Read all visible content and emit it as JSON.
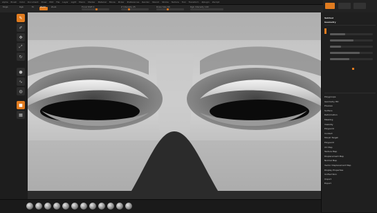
{
  "menubar": {
    "items": [
      "Alpha",
      "Brush",
      "Color",
      "Document",
      "Draw",
      "Edit",
      "File",
      "Layer",
      "Light",
      "Macro",
      "Marker",
      "Material",
      "Movie",
      "Picker",
      "Preferences",
      "Render",
      "Stencil",
      "Stroke",
      "Texture",
      "Tool",
      "Transform",
      "Zplugin",
      "Zscript"
    ]
  },
  "topbar": {
    "mrgb": "Mrgb",
    "rgb": "Rgb",
    "m": "M",
    "zadd": "Zadd",
    "zsub": "Zsub",
    "zcut": "Zcut",
    "focal_shift": "Focal Shift 0",
    "draw_size": "Draw Size 64",
    "z_intensity": "Z Intensity 25",
    "rgb_intensity": "Rgb Intensity 100",
    "accent": "#e07b1f"
  },
  "left_tools": {
    "icons": [
      "edit-icon",
      "draw-icon",
      "move-icon",
      "scale-icon",
      "rotate-icon",
      "brush-icon",
      "material-icon",
      "texture-icon",
      "color-icon",
      "stroke-icon",
      "alpha-icon"
    ]
  },
  "viewport": {
    "subject": "sculpted face close-up",
    "background": "#2b2b2b"
  },
  "bottom_brushes": 12,
  "right_panel": {
    "header1": "Subtool",
    "header2": "Geometry",
    "items": [
      "Polygroups",
      "Geometry HD",
      "Preview",
      "Surface",
      "Deformation",
      "Masking",
      "Visibility",
      "Polypaint",
      "Contact",
      "Morph Target",
      "Polypaint",
      "UV Map",
      "Texture Map",
      "Displacement Map",
      "Normal Map",
      "Vector Displacement Map",
      "Display Properties",
      "Unified Skin",
      "Import",
      "Export"
    ],
    "sliders": [
      0.35,
      0.55,
      0.25,
      0.7,
      0.45
    ]
  }
}
